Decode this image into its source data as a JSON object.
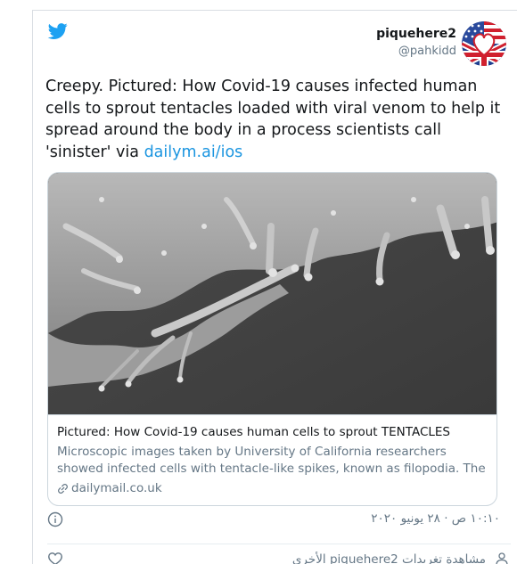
{
  "author": {
    "name": "piquehere2",
    "handle": "@pahkidd"
  },
  "tweet": {
    "text": "Creepy.  Pictured: How Covid-19 causes infected human cells to sprout tentacles loaded with viral venom to help it spread around the body in a process scientists call 'sinister' via ",
    "link_text": "dailym.ai/ios"
  },
  "card": {
    "title": "Pictured: How Covid-19 causes human cells to sprout TENTACLES",
    "description": "Microscopic images taken by University of California researchers showed infected cells with tentacle-like spikes, known as filopodia. The discovery ...",
    "domain": "dailymail.co.uk"
  },
  "footer": {
    "timestamp": "١٠:١٠ ص · ٢٨ يونيو ٢٠٢٠"
  },
  "bottom": {
    "view_more": "مشاهدة تغريدات piquehere2 الأخرى"
  },
  "colors": {
    "twitter_blue": "#1da1f2",
    "link": "#1b95e0",
    "secondary_text": "#657786"
  }
}
